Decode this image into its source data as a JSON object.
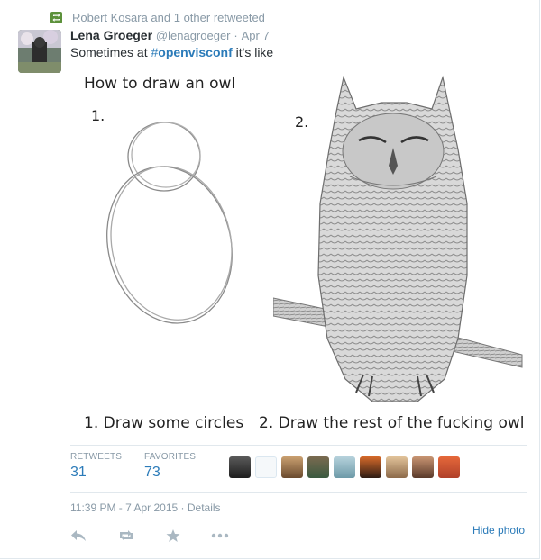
{
  "retweet_line": "Robert Kosara and 1 other retweeted",
  "tweet": {
    "name": "Lena Groeger",
    "handle": "@lenagroeger",
    "separator": "·",
    "date": "Apr 7",
    "text_before": "Sometimes at ",
    "hashtag_symbol": "#",
    "hashtag": "openvisconf",
    "text_after": " it's like"
  },
  "image": {
    "title": "How to draw an owl",
    "step1_number": "1.",
    "step2_number": "2.",
    "caption1": "1. Draw some circles",
    "caption2": "2. Draw the rest of the fucking owl"
  },
  "stats": {
    "retweets_label": "RETWEETS",
    "retweets_value": "31",
    "favorites_label": "FAVORITES",
    "favorites_value": "73"
  },
  "timestamp": "11:39 PM - 7 Apr 2015 · Details",
  "hide_photo": "Hide photo",
  "colors": {
    "link": "#2b7bb9",
    "muted": "#8899a6",
    "text": "#292f33",
    "retweet_green": "#5c913b"
  },
  "icons": [
    "retweet-icon",
    "reply-icon",
    "favorite-icon",
    "more-icon"
  ]
}
